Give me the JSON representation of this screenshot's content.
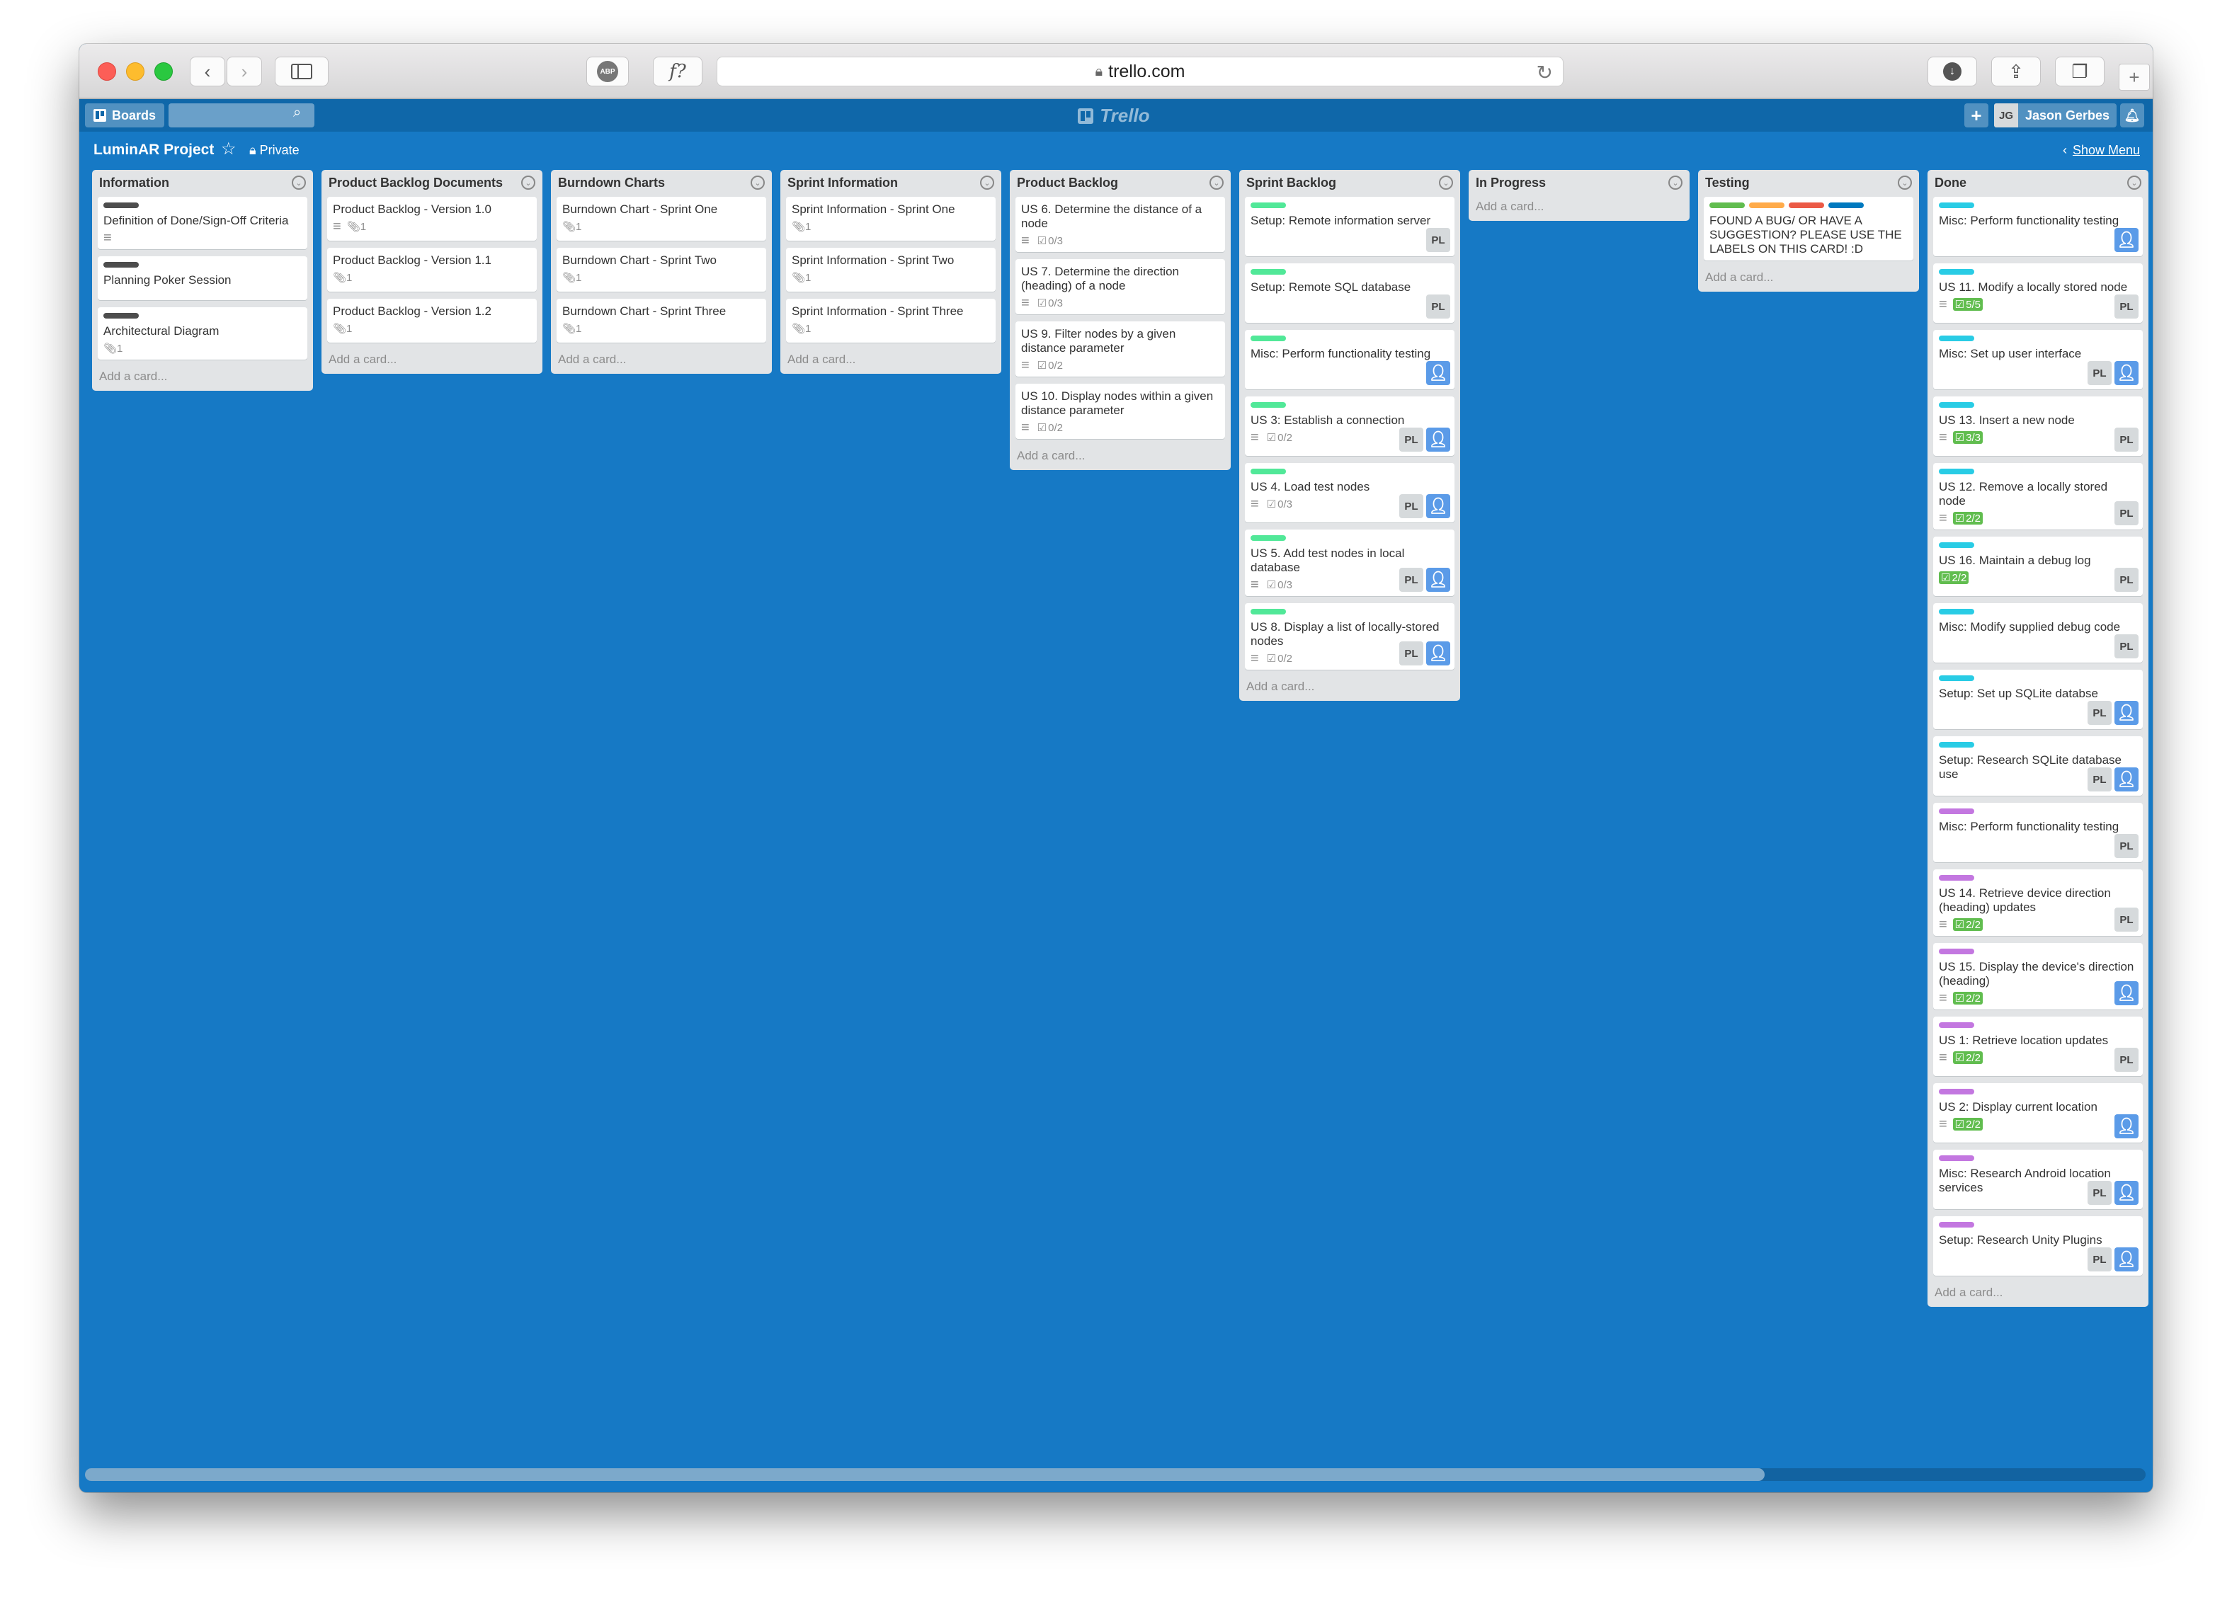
{
  "browser": {
    "url": "trello.com",
    "abp_label": "ABP",
    "fx_label": "f?"
  },
  "header": {
    "boards_label": "Boards",
    "logo_text": "Trello",
    "user_initials": "JG",
    "user_name": "Jason Gerbes"
  },
  "board": {
    "title": "LuminAR Project",
    "visibility": "Private",
    "show_menu": "Show Menu"
  },
  "colors": {
    "board_bg": "#1679c5",
    "green": "#61bd4f",
    "orange": "#ffab4a",
    "red": "#eb5a46",
    "blue": "#0079bf",
    "cyan": "#29cce5",
    "purple": "#c377e0",
    "black": "#4d4d4d",
    "lime": "#51e898"
  },
  "add_card_text": "Add a card...",
  "lists": [
    {
      "title": "Information",
      "cards": [
        {
          "title": "Definition of Done/Sign-Off Criteria",
          "labels": [
            "#4d4d4d"
          ],
          "desc": true
        },
        {
          "title": "Planning Poker Session",
          "labels": [
            "#4d4d4d"
          ]
        },
        {
          "title": "Architectural Diagram",
          "labels": [
            "#4d4d4d"
          ],
          "attach": "1"
        }
      ]
    },
    {
      "title": "Product Backlog Documents",
      "cards": [
        {
          "title": "Product Backlog - Version 1.0",
          "desc": true,
          "attach": "1"
        },
        {
          "title": "Product Backlog - Version 1.1",
          "attach": "1"
        },
        {
          "title": "Product Backlog - Version 1.2",
          "attach": "1"
        }
      ]
    },
    {
      "title": "Burndown Charts",
      "cards": [
        {
          "title": "Burndown Chart - Sprint One",
          "attach": "1"
        },
        {
          "title": "Burndown Chart - Sprint Two",
          "attach": "1"
        },
        {
          "title": "Burndown Chart - Sprint Three",
          "attach": "1"
        }
      ]
    },
    {
      "title": "Sprint Information",
      "cards": [
        {
          "title": "Sprint Information - Sprint One",
          "attach": "1"
        },
        {
          "title": "Sprint Information - Sprint Two",
          "attach": "1"
        },
        {
          "title": "Sprint Information - Sprint Three",
          "attach": "1"
        }
      ]
    },
    {
      "title": "Product Backlog",
      "cards": [
        {
          "title": "US 6. Determine the distance of a node",
          "desc": true,
          "check": "0/3"
        },
        {
          "title": "US 7. Determine the direction (heading) of a node",
          "desc": true,
          "check": "0/3"
        },
        {
          "title": "US 9. Filter nodes by a given distance parameter",
          "desc": true,
          "check": "0/2"
        },
        {
          "title": "US 10. Display nodes within a given distance parameter",
          "desc": true,
          "check": "0/2"
        }
      ]
    },
    {
      "title": "Sprint Backlog",
      "cards": [
        {
          "title": "Setup: Remote information server",
          "labels": [
            "#51e898"
          ],
          "members": [
            "PL"
          ]
        },
        {
          "title": "Setup: Remote SQL database",
          "labels": [
            "#51e898"
          ],
          "members": [
            "PL"
          ]
        },
        {
          "title": "Misc: Perform functionality testing",
          "labels": [
            "#51e898"
          ],
          "members": [
            "avatar"
          ]
        },
        {
          "title": "US 3: Establish a connection",
          "labels": [
            "#51e898"
          ],
          "desc": true,
          "check": "0/2",
          "members": [
            "PL",
            "avatar"
          ]
        },
        {
          "title": "US 4. Load test nodes",
          "labels": [
            "#51e898"
          ],
          "desc": true,
          "check": "0/3",
          "members": [
            "PL",
            "avatar"
          ]
        },
        {
          "title": "US 5. Add test nodes in local database",
          "labels": [
            "#51e898"
          ],
          "desc": true,
          "check": "0/3",
          "members": [
            "PL",
            "avatar"
          ]
        },
        {
          "title": "US 8. Display a list of locally-stored nodes",
          "labels": [
            "#51e898"
          ],
          "desc": true,
          "check": "0/2",
          "members": [
            "PL",
            "avatar"
          ]
        }
      ]
    },
    {
      "title": "In Progress",
      "cards": []
    },
    {
      "title": "Testing",
      "cards": [
        {
          "title": "FOUND A BUG/ OR HAVE A SUGGESTION? PLEASE USE THE LABELS ON THIS CARD! :D",
          "labels": [
            "#61bd4f",
            "#ffab4a",
            "#eb5a46",
            "#0079bf"
          ]
        }
      ]
    },
    {
      "title": "Done",
      "cards": [
        {
          "title": "Misc: Perform functionality testing",
          "labels": [
            "#29cce5"
          ],
          "members": [
            "avatar"
          ]
        },
        {
          "title": "US 11. Modify a locally stored node",
          "labels": [
            "#29cce5"
          ],
          "desc": true,
          "check": "5/5",
          "check_done": true,
          "members": [
            "PL"
          ]
        },
        {
          "title": "Misc: Set up user interface",
          "labels": [
            "#29cce5"
          ],
          "members": [
            "PL",
            "avatar"
          ]
        },
        {
          "title": "US 13. Insert a new node",
          "labels": [
            "#29cce5"
          ],
          "desc": true,
          "check": "3/3",
          "check_done": true,
          "members": [
            "PL"
          ]
        },
        {
          "title": "US 12. Remove a locally stored node",
          "labels": [
            "#29cce5"
          ],
          "desc": true,
          "check": "2/2",
          "check_done": true,
          "members": [
            "PL"
          ]
        },
        {
          "title": "US 16. Maintain a debug log",
          "labels": [
            "#29cce5"
          ],
          "check": "2/2",
          "check_done": true,
          "members": [
            "PL"
          ]
        },
        {
          "title": "Misc: Modify supplied debug code",
          "labels": [
            "#29cce5"
          ],
          "members": [
            "PL"
          ]
        },
        {
          "title": "Setup: Set up SQLite databse",
          "labels": [
            "#29cce5"
          ],
          "members": [
            "PL",
            "avatar"
          ]
        },
        {
          "title": "Setup: Research SQLite database use",
          "labels": [
            "#29cce5"
          ],
          "members": [
            "PL",
            "avatar"
          ]
        },
        {
          "title": "Misc: Perform functionality testing",
          "labels": [
            "#c377e0"
          ],
          "members": [
            "PL"
          ]
        },
        {
          "title": "US 14. Retrieve device direction (heading) updates",
          "labels": [
            "#c377e0"
          ],
          "desc": true,
          "check": "2/2",
          "check_done": true,
          "members": [
            "PL"
          ]
        },
        {
          "title": "US 15. Display the device's direction (heading)",
          "labels": [
            "#c377e0"
          ],
          "desc": true,
          "check": "2/2",
          "check_done": true,
          "members": [
            "avatar"
          ]
        },
        {
          "title": "US 1: Retrieve location updates",
          "labels": [
            "#c377e0"
          ],
          "desc": true,
          "check": "2/2",
          "check_done": true,
          "members": [
            "PL"
          ]
        },
        {
          "title": "US 2: Display current location",
          "labels": [
            "#c377e0"
          ],
          "desc": true,
          "check": "2/2",
          "check_done": true,
          "members": [
            "avatar"
          ]
        },
        {
          "title": "Misc: Research Android location services",
          "labels": [
            "#c377e0"
          ],
          "members": [
            "PL",
            "avatar"
          ]
        },
        {
          "title": "Setup: Research Unity Plugins",
          "labels": [
            "#c377e0"
          ],
          "members": [
            "PL",
            "avatar"
          ]
        }
      ]
    }
  ]
}
